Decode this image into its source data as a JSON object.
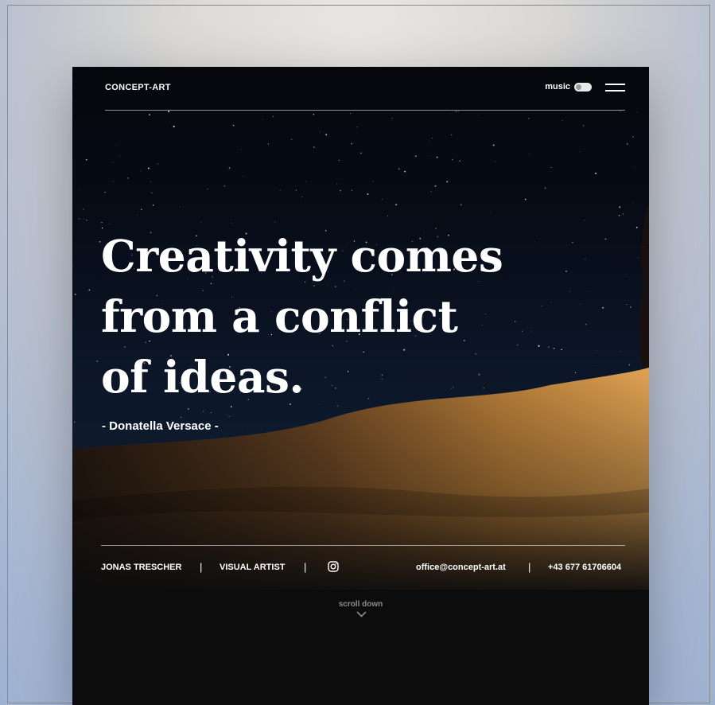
{
  "header": {
    "logo": "CONCEPT-ART",
    "music_label": "music",
    "menu_icon": "hamburger-menu-icon"
  },
  "hero": {
    "quote_line1": "Creativity comes",
    "quote_line2": "from a conflict",
    "quote_line3": "of ideas.",
    "author": "- Donatella Versace -"
  },
  "footer": {
    "name": "JONAS TRESCHER",
    "separator": "|",
    "role": "VISUAL ARTIST",
    "social_icon": "instagram-icon",
    "email": "office@concept-art.at",
    "phone": "+43 677 61706604"
  },
  "scroll": {
    "label": "scroll down",
    "icon": "chevron-down-icon"
  },
  "colors": {
    "background": "#0c0c0d",
    "text": "#ffffff",
    "sand": "#c98a3e",
    "muted": "#8c8c8c"
  }
}
